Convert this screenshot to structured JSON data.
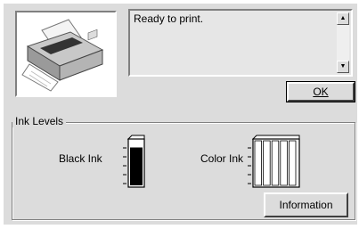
{
  "status": {
    "message": "Ready to print."
  },
  "buttons": {
    "ok_label": "OK",
    "information_label": "Information"
  },
  "ink_levels": {
    "group_label": "Ink Levels",
    "black_label": "Black Ink",
    "color_label": "Color Ink",
    "black_level": 0.85,
    "color_levels": [
      1.0,
      1.0,
      1.0,
      1.0,
      1.0
    ]
  },
  "icons": {
    "printer": "printer-icon",
    "scroll_up": "scroll-up-arrow-icon",
    "scroll_down": "scroll-down-arrow-icon",
    "black_cartridge": "black-ink-cartridge-icon",
    "color_cartridge": "color-ink-cartridge-icon"
  }
}
